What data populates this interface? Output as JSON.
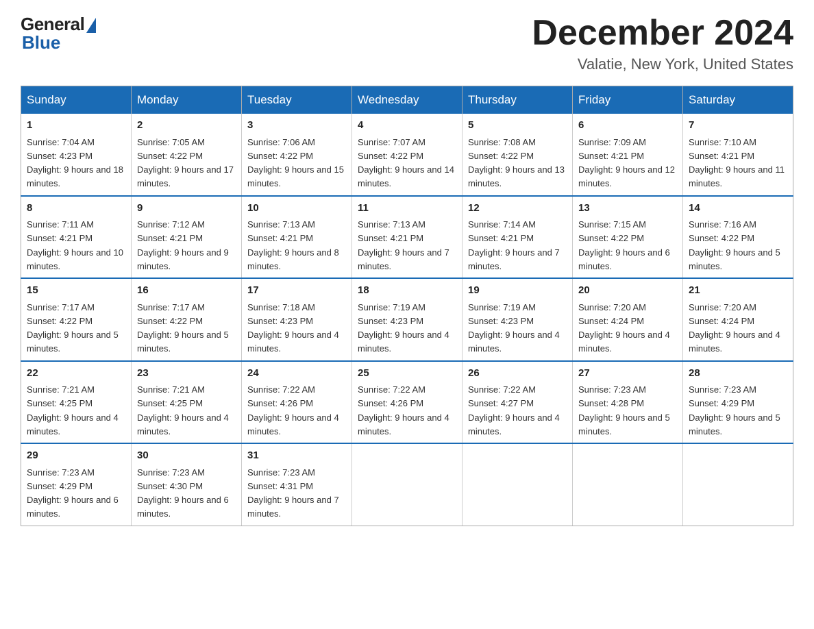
{
  "header": {
    "logo_general": "General",
    "logo_blue": "Blue",
    "month_title": "December 2024",
    "location": "Valatie, New York, United States"
  },
  "days_of_week": [
    "Sunday",
    "Monday",
    "Tuesday",
    "Wednesday",
    "Thursday",
    "Friday",
    "Saturday"
  ],
  "weeks": [
    [
      {
        "day": "1",
        "sunrise": "7:04 AM",
        "sunset": "4:23 PM",
        "daylight": "9 hours and 18 minutes."
      },
      {
        "day": "2",
        "sunrise": "7:05 AM",
        "sunset": "4:22 PM",
        "daylight": "9 hours and 17 minutes."
      },
      {
        "day": "3",
        "sunrise": "7:06 AM",
        "sunset": "4:22 PM",
        "daylight": "9 hours and 15 minutes."
      },
      {
        "day": "4",
        "sunrise": "7:07 AM",
        "sunset": "4:22 PM",
        "daylight": "9 hours and 14 minutes."
      },
      {
        "day": "5",
        "sunrise": "7:08 AM",
        "sunset": "4:22 PM",
        "daylight": "9 hours and 13 minutes."
      },
      {
        "day": "6",
        "sunrise": "7:09 AM",
        "sunset": "4:21 PM",
        "daylight": "9 hours and 12 minutes."
      },
      {
        "day": "7",
        "sunrise": "7:10 AM",
        "sunset": "4:21 PM",
        "daylight": "9 hours and 11 minutes."
      }
    ],
    [
      {
        "day": "8",
        "sunrise": "7:11 AM",
        "sunset": "4:21 PM",
        "daylight": "9 hours and 10 minutes."
      },
      {
        "day": "9",
        "sunrise": "7:12 AM",
        "sunset": "4:21 PM",
        "daylight": "9 hours and 9 minutes."
      },
      {
        "day": "10",
        "sunrise": "7:13 AM",
        "sunset": "4:21 PM",
        "daylight": "9 hours and 8 minutes."
      },
      {
        "day": "11",
        "sunrise": "7:13 AM",
        "sunset": "4:21 PM",
        "daylight": "9 hours and 7 minutes."
      },
      {
        "day": "12",
        "sunrise": "7:14 AM",
        "sunset": "4:21 PM",
        "daylight": "9 hours and 7 minutes."
      },
      {
        "day": "13",
        "sunrise": "7:15 AM",
        "sunset": "4:22 PM",
        "daylight": "9 hours and 6 minutes."
      },
      {
        "day": "14",
        "sunrise": "7:16 AM",
        "sunset": "4:22 PM",
        "daylight": "9 hours and 5 minutes."
      }
    ],
    [
      {
        "day": "15",
        "sunrise": "7:17 AM",
        "sunset": "4:22 PM",
        "daylight": "9 hours and 5 minutes."
      },
      {
        "day": "16",
        "sunrise": "7:17 AM",
        "sunset": "4:22 PM",
        "daylight": "9 hours and 5 minutes."
      },
      {
        "day": "17",
        "sunrise": "7:18 AM",
        "sunset": "4:23 PM",
        "daylight": "9 hours and 4 minutes."
      },
      {
        "day": "18",
        "sunrise": "7:19 AM",
        "sunset": "4:23 PM",
        "daylight": "9 hours and 4 minutes."
      },
      {
        "day": "19",
        "sunrise": "7:19 AM",
        "sunset": "4:23 PM",
        "daylight": "9 hours and 4 minutes."
      },
      {
        "day": "20",
        "sunrise": "7:20 AM",
        "sunset": "4:24 PM",
        "daylight": "9 hours and 4 minutes."
      },
      {
        "day": "21",
        "sunrise": "7:20 AM",
        "sunset": "4:24 PM",
        "daylight": "9 hours and 4 minutes."
      }
    ],
    [
      {
        "day": "22",
        "sunrise": "7:21 AM",
        "sunset": "4:25 PM",
        "daylight": "9 hours and 4 minutes."
      },
      {
        "day": "23",
        "sunrise": "7:21 AM",
        "sunset": "4:25 PM",
        "daylight": "9 hours and 4 minutes."
      },
      {
        "day": "24",
        "sunrise": "7:22 AM",
        "sunset": "4:26 PM",
        "daylight": "9 hours and 4 minutes."
      },
      {
        "day": "25",
        "sunrise": "7:22 AM",
        "sunset": "4:26 PM",
        "daylight": "9 hours and 4 minutes."
      },
      {
        "day": "26",
        "sunrise": "7:22 AM",
        "sunset": "4:27 PM",
        "daylight": "9 hours and 4 minutes."
      },
      {
        "day": "27",
        "sunrise": "7:23 AM",
        "sunset": "4:28 PM",
        "daylight": "9 hours and 5 minutes."
      },
      {
        "day": "28",
        "sunrise": "7:23 AM",
        "sunset": "4:29 PM",
        "daylight": "9 hours and 5 minutes."
      }
    ],
    [
      {
        "day": "29",
        "sunrise": "7:23 AM",
        "sunset": "4:29 PM",
        "daylight": "9 hours and 6 minutes."
      },
      {
        "day": "30",
        "sunrise": "7:23 AM",
        "sunset": "4:30 PM",
        "daylight": "9 hours and 6 minutes."
      },
      {
        "day": "31",
        "sunrise": "7:23 AM",
        "sunset": "4:31 PM",
        "daylight": "9 hours and 7 minutes."
      },
      null,
      null,
      null,
      null
    ]
  ]
}
